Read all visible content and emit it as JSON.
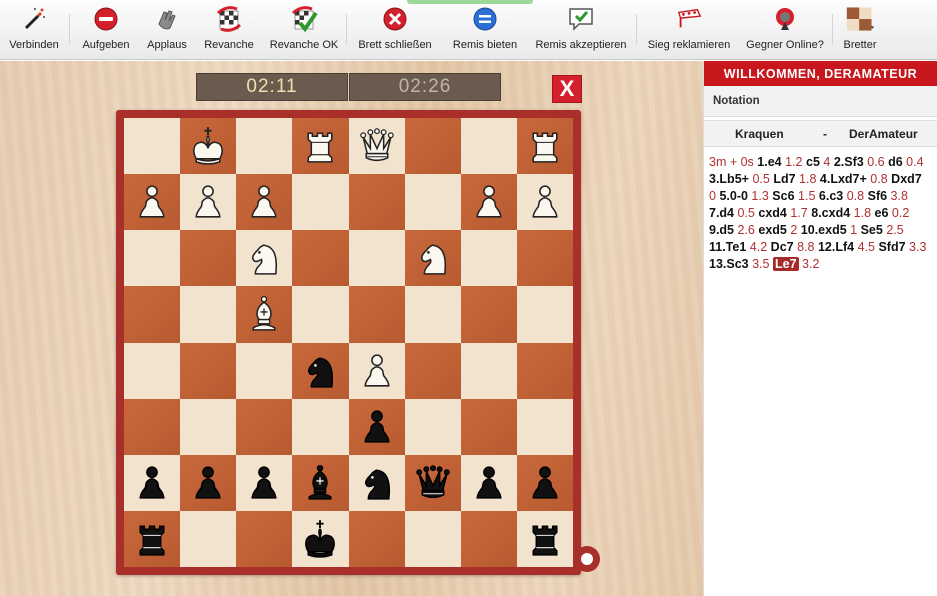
{
  "toolbar": {
    "items": [
      {
        "label": "Verbinden",
        "icon": "magic-wand-icon"
      },
      {
        "label": "Aufgeben",
        "icon": "no-entry-icon"
      },
      {
        "label": "Applaus",
        "icon": "clapping-hands-icon"
      },
      {
        "label": "Revanche",
        "icon": "revanche-board-icon"
      },
      {
        "label": "Revanche OK",
        "icon": "revanche-ok-icon"
      },
      {
        "label": "Brett schließen",
        "icon": "close-board-icon"
      },
      {
        "label": "Remis bieten",
        "icon": "offer-draw-icon"
      },
      {
        "label": "Remis akzeptieren",
        "icon": "accept-draw-icon"
      },
      {
        "label": "Sieg reklamieren",
        "icon": "claim-victory-icon"
      },
      {
        "label": "Gegner Online?",
        "icon": "opponent-online-icon"
      },
      {
        "label": "Bretter",
        "icon": "boards-icon"
      }
    ],
    "colors": {
      "red": "#d4202c",
      "blue": "#2a6fd3",
      "green": "#2e9a2e"
    }
  },
  "clocks": {
    "left": "02:11",
    "right": "02:26"
  },
  "close_label": "X",
  "board": {
    "rows": [
      [
        "",
        "wK",
        "",
        "wR",
        "wQ",
        "",
        "",
        "wR"
      ],
      [
        "wP",
        "wP",
        "wP",
        "",
        "",
        "",
        "wP",
        "wP"
      ],
      [
        "",
        "",
        "wN",
        "",
        "",
        "wN",
        "",
        ""
      ],
      [
        "",
        "",
        "wB",
        "",
        "",
        "",
        "",
        ""
      ],
      [
        "",
        "",
        "",
        "bN",
        "wP",
        "",
        "",
        ""
      ],
      [
        "",
        "",
        "",
        "",
        "bP",
        "",
        "",
        ""
      ],
      [
        "bP",
        "bP",
        "bP",
        "bB",
        "bN",
        "bQ",
        "bP",
        "bP"
      ],
      [
        "bR",
        "",
        "",
        "bK",
        "",
        "",
        "",
        "bR"
      ]
    ],
    "light_color": "#f2e3cf",
    "dark_color": "#c0623a",
    "frame_color": "#a9302a"
  },
  "panel": {
    "welcome": "WILLKOMMEN, DERAMATEUR",
    "notation_title": "Notation",
    "player_white": "Kraquen",
    "separator": "-",
    "player_black": "DerAmateur",
    "moves": [
      {
        "k": "t",
        "v": "3m + 0s"
      },
      {
        "k": "m",
        "v": "1.e4"
      },
      {
        "k": "t",
        "v": "1.2"
      },
      {
        "k": "m",
        "v": "c5"
      },
      {
        "k": "t",
        "v": "4"
      },
      {
        "k": "m",
        "v": "2.Sf3"
      },
      {
        "k": "t",
        "v": "0.6"
      },
      {
        "k": "m",
        "v": "d6"
      },
      {
        "k": "t",
        "v": "0.4"
      },
      {
        "k": "m",
        "v": "3.Lb5+"
      },
      {
        "k": "t",
        "v": "0.5"
      },
      {
        "k": "m",
        "v": "Ld7"
      },
      {
        "k": "t",
        "v": "1.8"
      },
      {
        "k": "m",
        "v": "4.Lxd7+"
      },
      {
        "k": "t",
        "v": "0.8"
      },
      {
        "k": "m",
        "v": "Dxd7"
      },
      {
        "k": "t",
        "v": "0"
      },
      {
        "k": "m",
        "v": "5.0-0"
      },
      {
        "k": "t",
        "v": "1.3"
      },
      {
        "k": "m",
        "v": "Sc6"
      },
      {
        "k": "t",
        "v": "1.5"
      },
      {
        "k": "m",
        "v": "6.c3"
      },
      {
        "k": "t",
        "v": "0.8"
      },
      {
        "k": "m",
        "v": "Sf6"
      },
      {
        "k": "t",
        "v": "3.8"
      },
      {
        "k": "m",
        "v": "7.d4"
      },
      {
        "k": "t",
        "v": "0.5"
      },
      {
        "k": "m",
        "v": "cxd4"
      },
      {
        "k": "t",
        "v": "1.7"
      },
      {
        "k": "m",
        "v": "8.cxd4"
      },
      {
        "k": "t",
        "v": "1.8"
      },
      {
        "k": "m",
        "v": "e6"
      },
      {
        "k": "t",
        "v": "0.2"
      },
      {
        "k": "m",
        "v": "9.d5"
      },
      {
        "k": "t",
        "v": "2.6"
      },
      {
        "k": "m",
        "v": "exd5"
      },
      {
        "k": "t",
        "v": "2"
      },
      {
        "k": "m",
        "v": "10.exd5"
      },
      {
        "k": "t",
        "v": "1"
      },
      {
        "k": "m",
        "v": "Se5"
      },
      {
        "k": "t",
        "v": "2.5"
      },
      {
        "k": "m",
        "v": "11.Te1"
      },
      {
        "k": "t",
        "v": "4.2"
      },
      {
        "k": "m",
        "v": "Dc7"
      },
      {
        "k": "t",
        "v": "8.8"
      },
      {
        "k": "m",
        "v": "12.Lf4"
      },
      {
        "k": "t",
        "v": "4.5"
      },
      {
        "k": "m",
        "v": "Sfd7"
      },
      {
        "k": "t",
        "v": "3.3"
      },
      {
        "k": "m",
        "v": "13.Sc3"
      },
      {
        "k": "t",
        "v": "3.5"
      },
      {
        "k": "cur",
        "v": "Le7"
      },
      {
        "k": "t",
        "v": "3.2"
      }
    ]
  }
}
